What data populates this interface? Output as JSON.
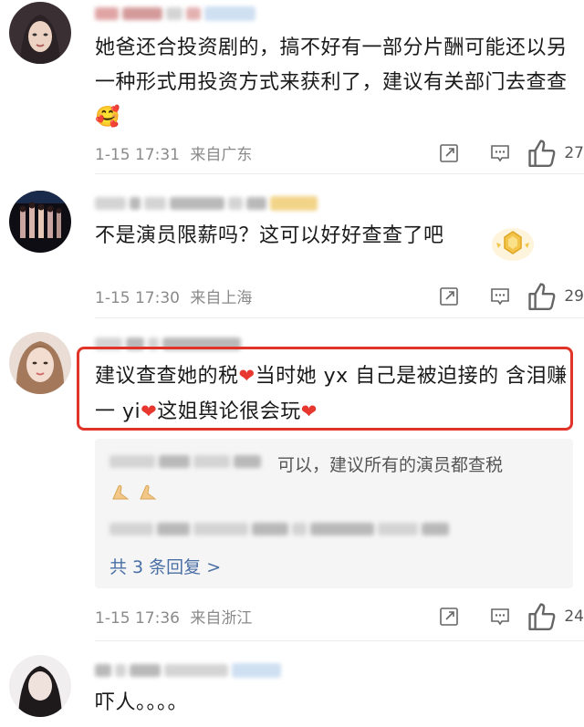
{
  "comments": [
    {
      "text": "她爸还合投资剧的，搞不好有一部分片酬可能还以另一种形式用投资方式来获利了，建议有关部门去查查",
      "emoji": "🥰",
      "time": "1-15 17:31",
      "location": "来自广东",
      "likes": "27"
    },
    {
      "text": "不是演员限薪吗？这可以好好查查了吧",
      "time": "1-15 17:30",
      "location": "来自上海",
      "likes": "29"
    },
    {
      "text_part1": "建议查查她的税",
      "text_part2": "当时她 yx 自己是被迫接的 含泪赚一 yi",
      "text_part3": "这姐舆论很会玩",
      "reply_text": "可以，建议所有的演员都查税",
      "reply_more": "共 3 条回复 >",
      "time": "1-15 17:36",
      "location": "来自浙江",
      "likes": "24"
    },
    {
      "text": "吓人。。。。"
    }
  ],
  "icons": {
    "share": "share-icon",
    "comment": "comment-icon",
    "like": "thumbs-up-icon",
    "heart": "heart-icon"
  },
  "colors": {
    "highlight": "#e0342a",
    "heart": "#e8372f",
    "link": "#4a6fa5"
  }
}
